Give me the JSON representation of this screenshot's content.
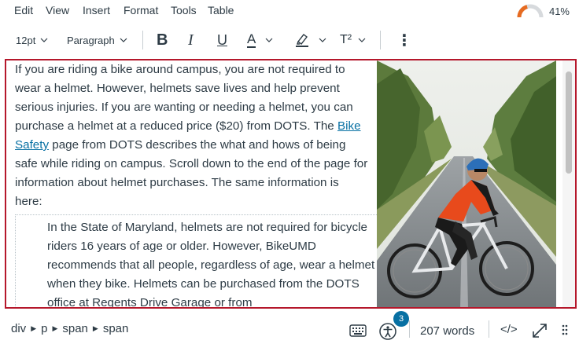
{
  "menubar": {
    "items": [
      "Edit",
      "View",
      "Insert",
      "Format",
      "Tools",
      "Table"
    ],
    "progress_text": "41%",
    "progress_value": 0.41
  },
  "toolbar": {
    "font_size": "12pt",
    "block_format": "Paragraph",
    "bold_label": "B",
    "italic_label": "I",
    "underline_label": "U",
    "text_color_label": "A",
    "superscript_label": "T²",
    "more_label": "⋮"
  },
  "editor": {
    "para_before_link": "If you are riding a bike around campus, you are not required to wear a helmet. However, helmets save lives and help prevent serious injuries. If you are wanting or needing a helmet, you can purchase a helmet at a reduced price ($20) from DOTS. The ",
    "link_text": "Bike Safety",
    "para_after_link": " page from DOTS describes the what and hows of being safe while riding on campus. Scroll down to the end of the page for information about helmet purchases. The same information is here:",
    "quote": "In the State of Maryland, helmets are not required for bicycle riders 16 years of age or older. However, BikeUMD recommends that all people, regardless of age, wear a helmet when they bike. Helmets can be purchased from the DOTS office at Regents Drive Garage or from"
  },
  "statusbar": {
    "path": [
      "div",
      "p",
      "span",
      "span"
    ],
    "a11y_badge": "3",
    "word_count": "207 words",
    "html_toggle": "</>"
  },
  "icons": {
    "keyboard": "keyboard-icon",
    "accessibility": "accessibility-icon",
    "fullscreen": "fullscreen-icon",
    "resize": "resize-handle-icon"
  },
  "colors": {
    "accent": "#0770a3",
    "editor_border": "#b5172b",
    "progress_fill": "#e66b21"
  }
}
